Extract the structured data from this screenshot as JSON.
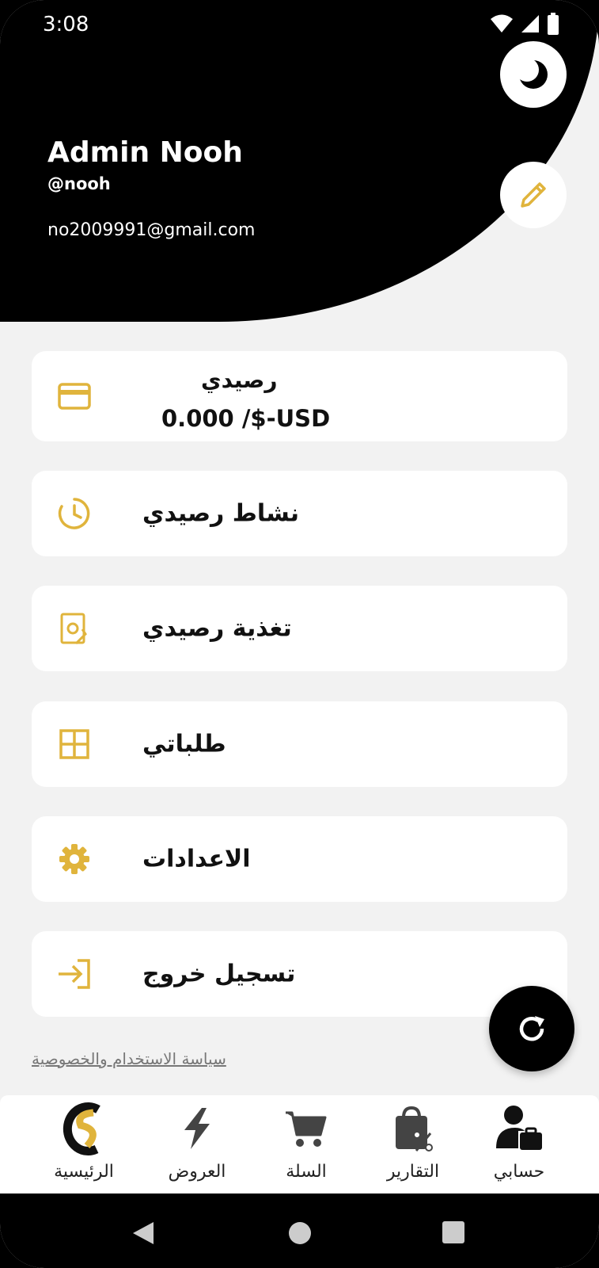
{
  "status_bar": {
    "time": "3:08"
  },
  "profile": {
    "name": "Admin Nooh",
    "handle": "@nooh",
    "email": "no2009991@gmail.com"
  },
  "balance": {
    "title": "رصيدي",
    "value": "0.000 /$-USD"
  },
  "menu": {
    "activity_label": "نشاط رصيدي",
    "topup_label": "تغذية رصيدي",
    "orders_label": "طلباتي",
    "settings_label": "الاعدادات",
    "logout_label": "تسجيل خروج"
  },
  "privacy_link": "سياسة الاستخدام والخصوصية",
  "bottom_nav": {
    "home": "الرئيسية",
    "offers": "العروض",
    "cart": "السلة",
    "reports": "التقارير",
    "account": "حسابي"
  },
  "colors": {
    "accent": "#E0B43C",
    "dark": "#000000",
    "background": "#F2F2F2",
    "card": "#FFFFFF"
  },
  "icons": {
    "theme": "moon-icon",
    "edit": "pencil-icon",
    "balance": "credit-card-icon",
    "activity": "clock-icon",
    "topup": "money-hand-icon",
    "orders": "grid-icon",
    "settings": "gear-icon",
    "logout": "login-arrow-icon",
    "refresh": "refresh-icon"
  }
}
